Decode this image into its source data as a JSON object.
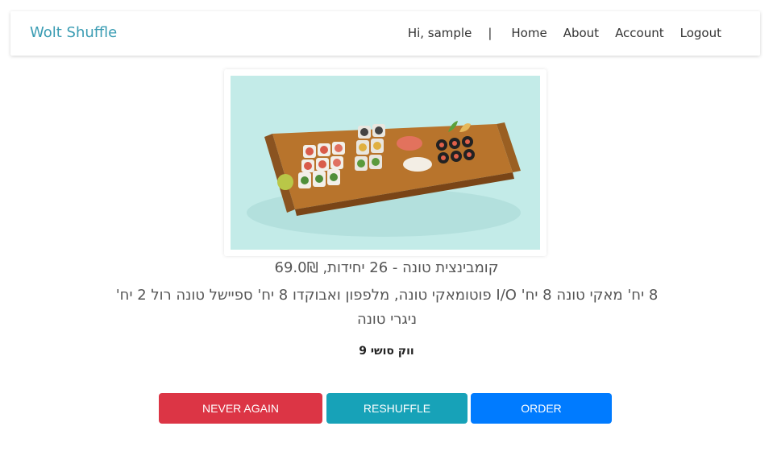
{
  "nav": {
    "brand": "Wolt Shuffle",
    "greeting": "Hi, sample",
    "separator": "|",
    "links": [
      "Home",
      "About",
      "Account",
      "Logout"
    ]
  },
  "dish": {
    "title": "קומבינצית טונה - 26 יחידות, 69.0₪",
    "description": "8 יח' מאקי טונה 8 יח' I/O פוטומאקי טונה, מלפפון ואבוקדו 8 יח' ספיישל טונה רול 2 יח' ניגרי טונה",
    "restaurant": "ווק סושי 9"
  },
  "actions": {
    "never_again": "NEVER AGAIN",
    "reshuffle": "RESHUFFLE",
    "order": "ORDER"
  }
}
